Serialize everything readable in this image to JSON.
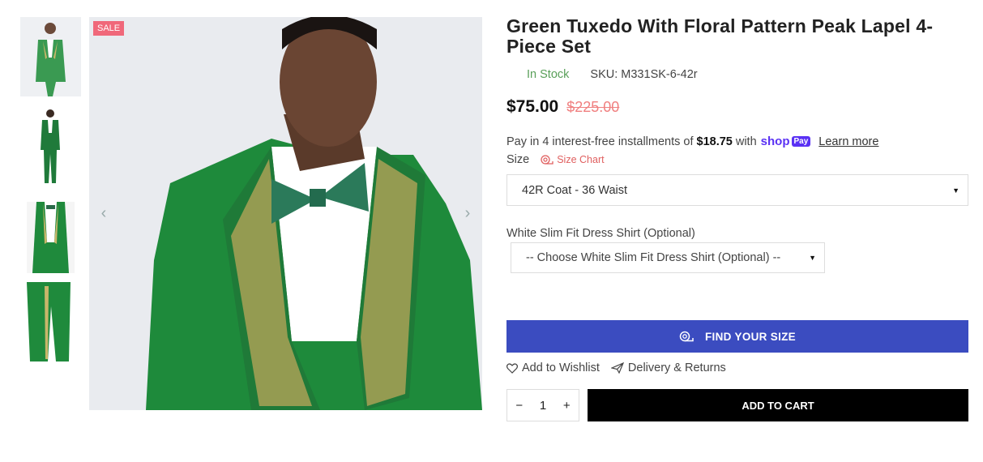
{
  "gallery": {
    "thumbnails": [
      {
        "alt": "green-tuxedo-full-front"
      },
      {
        "alt": "green-tuxedo-full-standing"
      },
      {
        "alt": "green-tuxedo-vest-detail"
      },
      {
        "alt": "green-tuxedo-pants-detail"
      }
    ],
    "sale_badge": "SALE",
    "prev_icon": "chevron-left-icon",
    "next_icon": "chevron-right-icon"
  },
  "product": {
    "title": "Green Tuxedo With Floral Pattern Peak Lapel 4-Piece Set",
    "stock": "In Stock",
    "sku": "SKU: M331SK-6-42r",
    "price": "$75.00",
    "old_price": "$225.00"
  },
  "installments": {
    "prefix": "Pay in 4 interest-free installments of",
    "amount": "$18.75",
    "with": "with",
    "brand": "shop",
    "brand_pay": "Pay",
    "learn_more": "Learn more"
  },
  "size": {
    "label": "Size",
    "chart_link": "Size Chart",
    "selected": "42R Coat - 36 Waist"
  },
  "shirt": {
    "label": "White Slim Fit Dress Shirt (Optional)",
    "selected": "-- Choose White Slim Fit Dress Shirt (Optional) --"
  },
  "actions": {
    "find_size": "FIND YOUR SIZE",
    "wishlist": "Add to Wishlist",
    "delivery": "Delivery & Returns",
    "qty_minus": "−",
    "qty_value": "1",
    "qty_plus": "+",
    "add_to_cart": "ADD TO CART"
  },
  "colors": {
    "accent_blue": "#3b4cc0",
    "sale_pink": "#f0687a",
    "stock_green": "#5aa05a",
    "shop_purple": "#5a31f4"
  }
}
